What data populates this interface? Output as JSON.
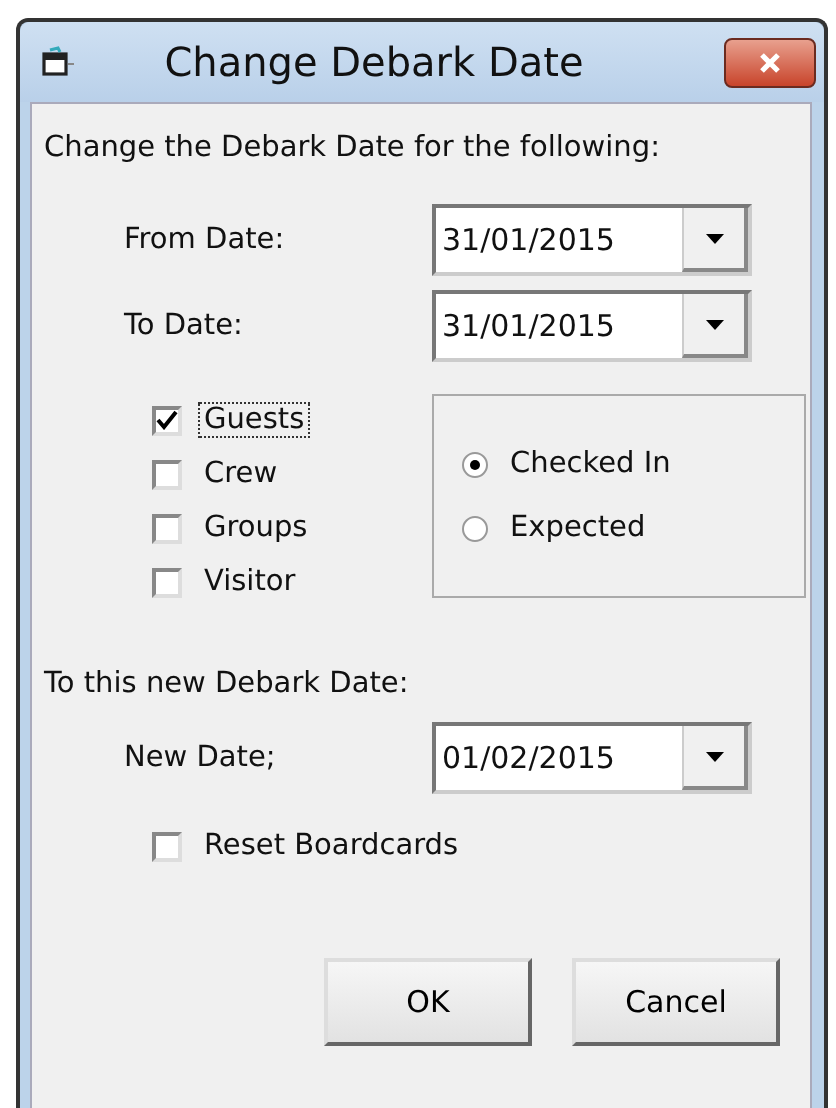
{
  "window": {
    "title": "Change Debark Date"
  },
  "heading": "Change the Debark Date for the following:",
  "date_fields": [
    {
      "label": "From Date:",
      "value": "31/01/2015"
    },
    {
      "label": "To Date:",
      "value": "31/01/2015"
    }
  ],
  "types": [
    {
      "label": "Guests",
      "checked": true,
      "focused": true
    },
    {
      "label": "Crew",
      "checked": false,
      "focused": false
    },
    {
      "label": "Groups",
      "checked": false,
      "focused": false
    },
    {
      "label": "Visitor",
      "checked": false,
      "focused": false
    }
  ],
  "status_options": [
    {
      "label": "Checked In",
      "selected": true
    },
    {
      "label": "Expected",
      "selected": false
    }
  ],
  "new_heading": "To this new Debark Date:",
  "new_date": {
    "label": "New Date;",
    "value": "01/02/2015"
  },
  "reset": {
    "label": "Reset Boardcards",
    "checked": false
  },
  "buttons": [
    "OK",
    "Cancel"
  ]
}
